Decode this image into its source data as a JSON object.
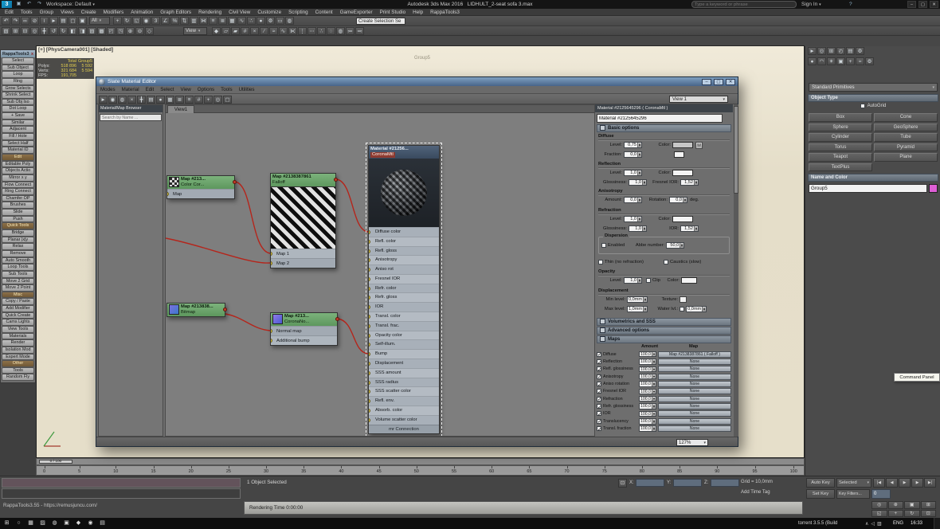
{
  "titlebar": {
    "workspace": "Workspace: Default",
    "app_title": "Autodesk 3ds Max 2016",
    "doc_title": "LIDHULT_2-seat sofa 3.max",
    "search_placeholder": "Type a keyword or phrase",
    "sign_in": "Sign In",
    "window_buttons": {
      "min": "–",
      "max": "▢",
      "close": "✕"
    }
  },
  "menubar": [
    "Edit",
    "Tools",
    "Group",
    "Views",
    "Create",
    "Modifiers",
    "Animation",
    "Graph Editors",
    "Rendering",
    "Civil View",
    "Customize",
    "Scripting",
    "Content",
    "GameExporter",
    "Print Studio",
    "Help",
    "RappaTools3"
  ],
  "toolbar": {
    "filter": "All",
    "named_set": "Create Selection Se",
    "ref_coord": "View",
    "row1a": [
      {
        "n": "undo-icon",
        "g": "↶"
      },
      {
        "n": "redo-icon",
        "g": "↷"
      },
      {
        "n": "link-icon",
        "g": "∞"
      },
      {
        "n": "unlink-icon",
        "g": "⊘"
      },
      {
        "n": "bind-spacewarp-icon",
        "g": "≀"
      },
      {
        "n": "select-object-icon",
        "g": "►"
      },
      {
        "n": "select-by-name-icon",
        "g": "▤"
      },
      {
        "n": "rect-region-icon",
        "g": "▢"
      },
      {
        "n": "crossing-region-icon",
        "g": "▣"
      }
    ],
    "row1b": [
      {
        "n": "move-icon",
        "g": "+"
      },
      {
        "n": "rotate-icon",
        "g": "↻"
      },
      {
        "n": "scale-icon",
        "g": "◱"
      },
      {
        "n": "pivot-center-icon",
        "g": "◉"
      },
      {
        "n": "snap-toggle-icon",
        "g": "3"
      },
      {
        "n": "angle-snap-icon",
        "g": "∠"
      },
      {
        "n": "percent-snap-icon",
        "g": "%"
      },
      {
        "n": "spinner-snap-icon",
        "g": "⇅"
      },
      {
        "n": "edit-named-selections-icon",
        "g": "▥"
      },
      {
        "n": "mirror-icon",
        "g": "⋈"
      },
      {
        "n": "align-icon",
        "g": "≡"
      },
      {
        "n": "layer-manager-icon",
        "g": "≣"
      },
      {
        "n": "graphite-ribbon-icon",
        "g": "▦"
      },
      {
        "n": "curve-editor-icon",
        "g": "∿"
      },
      {
        "n": "schematic-view-icon",
        "g": "∴"
      },
      {
        "n": "material-editor-icon",
        "g": "●"
      },
      {
        "n": "render-setup-icon",
        "g": "⚙"
      },
      {
        "n": "rendered-frame-icon",
        "g": "▭"
      },
      {
        "n": "render-production-icon",
        "g": "◍"
      }
    ],
    "row2a": [
      {
        "n": "snap-2d-icon",
        "g": "▧"
      },
      {
        "n": "poly-modeling-icon",
        "g": "⊞"
      },
      {
        "n": "freeform-icon",
        "g": "⊟"
      },
      {
        "n": "selection-paint-icon",
        "g": "◎"
      },
      {
        "n": "object-paint-icon",
        "g": "╋"
      },
      {
        "n": "populate-icon",
        "g": "↺"
      },
      {
        "n": "swift-loop-icon",
        "g": "↻"
      },
      {
        "n": "constraints-icon",
        "g": "◧"
      },
      {
        "n": "soft-selection-icon",
        "g": "◨"
      },
      {
        "n": "edge-mode-icon",
        "g": "▨"
      },
      {
        "n": "border-mode-icon",
        "g": "▩"
      },
      {
        "n": "element-mode-icon",
        "g": "◰"
      },
      {
        "n": "vertex-mode-icon",
        "g": "◳"
      },
      {
        "n": "extrude-icon",
        "g": "⊕"
      },
      {
        "n": "bevel-icon",
        "g": "⊖"
      },
      {
        "n": "inset-icon",
        "g": "◇"
      }
    ],
    "row2b": [
      {
        "n": "chamfer-icon",
        "g": "◆"
      },
      {
        "n": "bridge-tool-icon",
        "g": "▱"
      },
      {
        "n": "weld-icon",
        "g": "▰"
      },
      {
        "n": "target-weld-icon",
        "g": "#"
      },
      {
        "n": "cut-icon",
        "g": "×"
      },
      {
        "n": "quickslice-icon",
        "g": "∕"
      },
      {
        "n": "relax-tool-icon",
        "g": "≈"
      },
      {
        "n": "paint-deform-icon",
        "g": "∿"
      },
      {
        "n": "mirror-tool-icon",
        "g": "⋉"
      },
      {
        "n": "array-icon",
        "g": "⋮"
      },
      {
        "n": "spacing-icon",
        "g": "⋯"
      },
      {
        "n": "measure-icon",
        "g": "∴"
      },
      {
        "n": "isolate-icon",
        "g": "◌"
      },
      {
        "n": "display-floater-icon",
        "g": "◍"
      },
      {
        "n": "manage-layers-icon",
        "g": "≔"
      },
      {
        "n": "scene-explorer-icon",
        "g": "≕"
      }
    ]
  },
  "viewport": {
    "label": "[+] [PhysCamera001] [Shaded]",
    "group_label": "Group5",
    "time_slider": "0 / 100",
    "timeline_ticks": [
      "0",
      "5",
      "10",
      "15",
      "20",
      "25",
      "30",
      "35",
      "40",
      "45",
      "50",
      "55",
      "60",
      "65",
      "70",
      "75",
      "80",
      "85",
      "90",
      "95",
      "100"
    ],
    "stats": {
      "h_a": "Total",
      "h_b": "Group5",
      "polys_k": "Polys:",
      "polys_a": "518 896",
      "polys_b": "5 592",
      "verts_k": "Verts:",
      "verts_a": "321 684",
      "verts_b": "5 594",
      "fps_k": "FPS:",
      "fps_a": "191,705"
    }
  },
  "rappatools": {
    "title": "RappaTools3",
    "close": "x",
    "buttons": [
      {
        "label": "Select"
      },
      {
        "label": "Sub Object"
      },
      {
        "label": "Loop"
      },
      {
        "label": "Ring"
      },
      {
        "label": "Grow Selects"
      },
      {
        "label": "Shrink Select"
      },
      {
        "label": "Sub Obj Iso"
      },
      {
        "label": "Dot Loop"
      },
      {
        "label": "+ Save"
      },
      {
        "label": "Similar"
      },
      {
        "label": "Adjacent"
      },
      {
        "label": "Fill / Hole"
      },
      {
        "label": "Select Half"
      },
      {
        "label": "Material ID"
      },
      {
        "label": "Edit",
        "cls": "hdr"
      },
      {
        "label": "Editable Poly"
      },
      {
        "label": "Objects Actio"
      },
      {
        "label": "Mirror x y"
      },
      {
        "label": "Flow Connect"
      },
      {
        "label": "Ring Connect"
      },
      {
        "label": "Chamfer OP"
      },
      {
        "label": "Brushes"
      },
      {
        "label": "Slide"
      },
      {
        "label": "Push"
      },
      {
        "label": "Quick Tools",
        "cls": "hdr"
      },
      {
        "label": "Bridge"
      },
      {
        "label": "Planar |x|y"
      },
      {
        "label": "Relax"
      },
      {
        "label": "Remove"
      },
      {
        "label": "Auto Smooth"
      },
      {
        "label": "Loop Tools"
      },
      {
        "label": "Sub Tools"
      },
      {
        "label": "Move 2 Grid"
      },
      {
        "label": "Move 2 Point"
      },
      {
        "label": "Misc",
        "cls": "hdr"
      },
      {
        "label": "Copy / Paste"
      },
      {
        "label": "Add Modifier"
      },
      {
        "label": "Quick Create"
      },
      {
        "label": "Cams Lights"
      },
      {
        "label": "View Tools"
      },
      {
        "label": "Materials"
      },
      {
        "label": "Render"
      },
      {
        "label": "Isolation Mod"
      },
      {
        "label": "Expert Mode"
      },
      {
        "label": "Other",
        "cls": "hdr"
      },
      {
        "label": "Tools"
      },
      {
        "label": "Random Fly"
      }
    ]
  },
  "slate": {
    "title": "Slate Material Editor",
    "menus": [
      "Modes",
      "Material",
      "Edit",
      "Select",
      "View",
      "Options",
      "Tools",
      "Utilities"
    ],
    "toolbar_icons": [
      {
        "n": "select-tool-icon",
        "g": "►"
      },
      {
        "n": "pick-material-icon",
        "g": "◉"
      },
      {
        "n": "assign-material-icon",
        "g": "◍"
      },
      {
        "n": "delete-selected-icon",
        "g": "×"
      },
      {
        "n": "move-children-icon",
        "g": "╋"
      },
      {
        "n": "hide-unused-nodeslots-icon",
        "g": "▤"
      },
      {
        "n": "show-shaded-material-icon",
        "g": "●"
      },
      {
        "n": "show-background-icon",
        "g": "▦"
      },
      {
        "n": "layout-all-icon",
        "g": "≣"
      },
      {
        "n": "layout-children-icon",
        "g": "≡"
      },
      {
        "n": "material-id-channel-icon",
        "g": "#"
      },
      {
        "n": "pan-tool-icon",
        "g": "+"
      },
      {
        "n": "zoom-tool-icon",
        "g": "◎"
      },
      {
        "n": "zoom-region-icon",
        "g": "▢"
      }
    ],
    "view_selector": "View 1",
    "view_tab": "View1",
    "status_zoom": "127%",
    "browser": {
      "title": "Material/Map Browser",
      "search_placeholder": "Search by Name ..."
    },
    "nodes": {
      "colorcorrect": {
        "title": "Map #213...",
        "subtitle": "Color Cor...",
        "slot": "Map"
      },
      "falloff": {
        "title": "Map #2138387861",
        "subtitle": "Falloff",
        "slots": [
          "Map 1",
          "Map 2"
        ]
      },
      "bitmap": {
        "title": "Map #213838...",
        "subtitle": "Bitmap"
      },
      "coronanormal": {
        "title": "Map #213...",
        "subtitle": "CoronaNo...",
        "slots": [
          "Normal map",
          "Additional bump"
        ]
      },
      "coronamtl": {
        "title": "Material #21256...",
        "subtitle": "CoronaMtl",
        "slots": [
          "Diffuse color",
          "Refl. color",
          "Refl. gloss",
          "Anisotropy",
          "Aniso rot",
          "Fresnel IOR",
          "Refr. color",
          "Refr. gloss",
          "IOR",
          "Transl. color",
          "Transl. frac.",
          "Opacity color",
          "Self-illum.",
          "Bump",
          "Displacement",
          "SSS amount",
          "SSS radius",
          "SSS scatter color",
          "Refl. env.",
          "Absorb. color",
          "Volume scatter color"
        ],
        "footer_slot": "mr Connection"
      }
    },
    "params": {
      "header": "Material #2125645296 ( CoronaMtl )",
      "name_value": "Material #2125645296",
      "rollout_basic": "Basic options",
      "rollout_volumetrics": "Volumetrics and SSS",
      "rollout_advanced": "Advanced options",
      "rollout_maps": "Maps",
      "diffuse": {
        "section": "Diffuse",
        "level_label": "Level:",
        "level": "0,75",
        "color_label": "Color:",
        "m_button": "M",
        "fraction_label": "Fraction:",
        "fraction": "0,0"
      },
      "reflection": {
        "section": "Reflection",
        "level_label": "Level:",
        "level": "1,0",
        "color_label": "Color:",
        "gloss_label": "Glossiness:",
        "gloss": "1,0",
        "fresnel_label": "Fresnel IOR:",
        "fresnel": "1,52",
        "aniso_section": "Anisotropy",
        "amount_label": "Amount:",
        "amount": "0,0",
        "rotation_label": "Rotation:",
        "rotation": "0,0",
        "deg_label": "deg."
      },
      "refraction": {
        "section": "Refraction",
        "level_label": "Level:",
        "level": "1,0",
        "color_label": "Color:",
        "gloss_label": "Glossiness:",
        "gloss": "1,0",
        "ior_label": "IOR:",
        "ior": "1,52",
        "dispersion_section": "Dispersion",
        "enabled_label": "Enabled",
        "abbe_label": "Abbe number:",
        "abbe": "50,0",
        "thin_label": "Thin (no refraction)",
        "caustics_label": "Caustics (slow)"
      },
      "opacity": {
        "section": "Opacity",
        "level_label": "Level:",
        "level": "1,0",
        "clip_label": "Clip",
        "color_label": "Color:"
      },
      "displacement": {
        "section": "Displacement",
        "min_label": "Min level:",
        "min": "0,0mm",
        "max_label": "Max level:",
        "max": "1,0mm",
        "texture_label": "Texture:",
        "water_label": "Water lvl.:",
        "water": "0,0mm"
      },
      "maps": {
        "amount_header": "Amount",
        "map_header": "Map",
        "rows": [
          {
            "label": "Diffuse",
            "amount": "100,0",
            "map": "Map #2138387861 ( Falloff )"
          },
          {
            "label": "Reflection",
            "amount": "100,0",
            "map": "None"
          },
          {
            "label": "Refl. glossiness",
            "amount": "100,0",
            "map": "None"
          },
          {
            "label": "Anisotropy",
            "amount": "100,0",
            "map": "None"
          },
          {
            "label": "Aniso rotation",
            "amount": "100,0",
            "map": "None"
          },
          {
            "label": "Fresnel IOR",
            "amount": "100,0",
            "map": "None"
          },
          {
            "label": "Refraction",
            "amount": "100,0",
            "map": "None"
          },
          {
            "label": "Refr. glossiness",
            "amount": "100,0",
            "map": "None"
          },
          {
            "label": "IOR",
            "amount": "100,0",
            "map": "None"
          },
          {
            "label": "Translucency",
            "amount": "100,0",
            "map": "None"
          },
          {
            "label": "Transl. fraction",
            "amount": "100,0",
            "map": "None"
          }
        ]
      }
    }
  },
  "command_panel": {
    "tabs": [
      {
        "n": "create-tab-icon",
        "g": "►"
      },
      {
        "n": "modify-tab-icon",
        "g": "◎"
      },
      {
        "n": "hierarchy-tab-icon",
        "g": "⊞"
      },
      {
        "n": "motion-tab-icon",
        "g": "◴"
      },
      {
        "n": "display-tab-icon",
        "g": "▤"
      },
      {
        "n": "utilities-tab-icon",
        "g": "⚙"
      }
    ],
    "categories": [
      {
        "n": "geometry-icon",
        "g": "●"
      },
      {
        "n": "shapes-icon",
        "g": "◠"
      },
      {
        "n": "lights-icon",
        "g": "☀"
      },
      {
        "n": "cameras-icon",
        "g": "▣"
      },
      {
        "n": "helpers-icon",
        "g": "+"
      },
      {
        "n": "spacewarps-icon",
        "g": "≈"
      },
      {
        "n": "systems-icon",
        "g": "⚙"
      }
    ],
    "dropdown": "Standard Primitives",
    "rollout_object_type": "Object Type",
    "autogrid": "AutoGrid",
    "buttons": [
      "Box",
      "Cone",
      "Sphere",
      "GeoSphere",
      "Cylinder",
      "Tube",
      "Torus",
      "Pyramid",
      "Teapot",
      "Plane",
      "TextPlus"
    ],
    "rollout_name_color": "Name and Color",
    "name_value": "Group5",
    "tooltip": "Command Panel"
  },
  "status": {
    "selection": "1 Object Selected",
    "grid": "Grid = 10,0mm",
    "add_time_tag": "Add Time Tag",
    "x_label": "X:",
    "y_label": "Y:",
    "z_label": "Z:",
    "auto_key": "Auto Key",
    "selected_mode": "Selected",
    "set_key": "Set Key",
    "key_filters": "Key Filters...",
    "frame_field": "0",
    "rappa_line": "RappaTools3.55  -  https://remusjuncu.com/",
    "rendering_time": "Rendering Time  0:00:00",
    "transport": [
      {
        "n": "go-start-icon",
        "g": "|◀"
      },
      {
        "n": "prev-frame-icon",
        "g": "◀"
      },
      {
        "n": "play-icon",
        "g": "▶"
      },
      {
        "n": "next-frame-icon",
        "g": "▶"
      },
      {
        "n": "go-end-icon",
        "g": "▶|"
      }
    ],
    "nav": [
      {
        "n": "zoom-icon",
        "g": "◎"
      },
      {
        "n": "zoom-all-icon",
        "g": "⊕"
      },
      {
        "n": "zoom-extents-icon",
        "g": "▣"
      },
      {
        "n": "zoom-extents-all-icon",
        "g": "⊞"
      },
      {
        "n": "fov-icon",
        "g": "◱"
      },
      {
        "n": "pan-icon",
        "g": "+"
      },
      {
        "n": "orbit-icon",
        "g": "↻"
      },
      {
        "n": "maximize-viewport-icon",
        "g": "⊡"
      }
    ]
  },
  "taskbar": {
    "apps": [
      {
        "n": "start-button",
        "g": "⊞"
      },
      {
        "n": "taskbar-search-icon",
        "g": "○"
      },
      {
        "n": "task-view-icon",
        "g": "▦"
      },
      {
        "n": "file-explorer-icon",
        "g": "▨"
      },
      {
        "n": "browser-icon",
        "g": "◍"
      },
      {
        "n": "media-app-icon",
        "g": "▣"
      },
      {
        "n": "3dsmax-taskbar-icon",
        "g": "◆"
      },
      {
        "n": "paint-app-icon",
        "g": "◉"
      },
      {
        "n": "notes-app-icon",
        "g": "▤"
      }
    ],
    "tray": [
      {
        "n": "tray-expand-icon",
        "g": "∧"
      },
      {
        "n": "volume-icon",
        "g": "◁"
      },
      {
        "n": "network-icon",
        "g": "▥"
      }
    ],
    "torrent": "torrent 3.5.5 (Build",
    "lang": "ENG",
    "time": "16:33"
  }
}
